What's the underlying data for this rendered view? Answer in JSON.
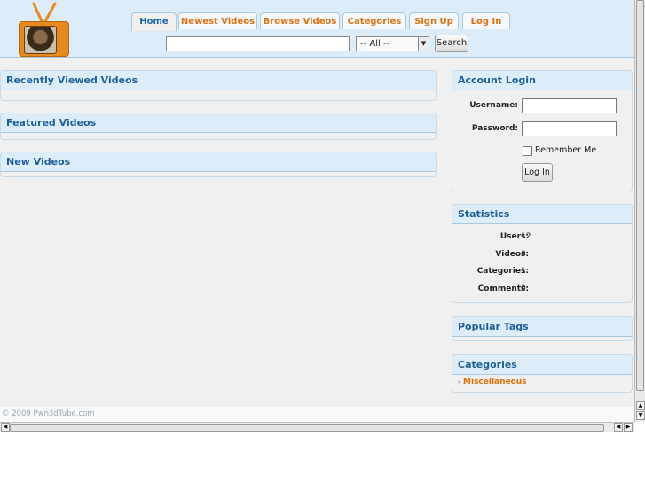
{
  "nav": {
    "tabs": [
      {
        "label": "Home",
        "active": true
      },
      {
        "label": "Newest Videos"
      },
      {
        "label": "Browse Videos"
      },
      {
        "label": "Categories"
      },
      {
        "label": "Sign Up"
      },
      {
        "label": "Log In"
      }
    ]
  },
  "search": {
    "value": "",
    "category": "-- All --",
    "button": "Search"
  },
  "main": {
    "recent": "Recently Viewed Videos",
    "featured": "Featured Videos",
    "new": "New Videos"
  },
  "login": {
    "title": "Account Login",
    "username_label": "Username:",
    "password_label": "Password:",
    "remember": "Remember Me",
    "button": "Log In"
  },
  "stats": {
    "title": "Statistics",
    "rows": [
      {
        "label": "Users:",
        "value": "12"
      },
      {
        "label": "Videos:",
        "value": "0"
      },
      {
        "label": "Categories:",
        "value": "1"
      },
      {
        "label": "Comments:",
        "value": "0"
      }
    ]
  },
  "tags": {
    "title": "Popular Tags"
  },
  "categories": {
    "title": "Categories",
    "items": [
      {
        "label": "Miscellaneous"
      }
    ]
  },
  "footer": {
    "copyright": "© 2009 Pwn3dTube.com"
  },
  "theme": {
    "accent": "#e07010",
    "link": "#1f5f99",
    "header_bg": "#dcecf8"
  }
}
